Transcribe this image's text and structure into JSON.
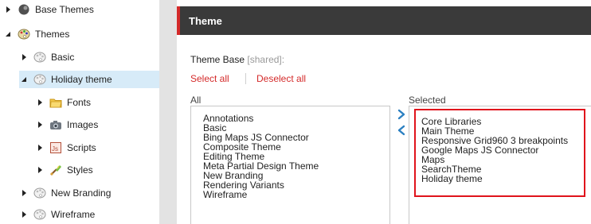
{
  "tree": {
    "items": [
      {
        "label": "Base Themes",
        "icon": "base-themes-icon",
        "expanded": false,
        "selected": false
      },
      {
        "label": "Themes",
        "icon": "themes-icon",
        "expanded": true,
        "selected": false
      },
      {
        "label": "Basic",
        "icon": "theme-icon",
        "expanded": false,
        "selected": false
      },
      {
        "label": "Holiday theme",
        "icon": "theme-icon",
        "expanded": true,
        "selected": true
      },
      {
        "label": "Fonts",
        "icon": "folder-icon",
        "expanded": false,
        "selected": false
      },
      {
        "label": "Images",
        "icon": "images-icon",
        "expanded": false,
        "selected": false
      },
      {
        "label": "Scripts",
        "icon": "script-icon",
        "expanded": false,
        "selected": false
      },
      {
        "label": "Styles",
        "icon": "styles-icon",
        "expanded": false,
        "selected": false
      },
      {
        "label": "New Branding",
        "icon": "theme-icon",
        "expanded": false,
        "selected": false
      },
      {
        "label": "Wireframe",
        "icon": "theme-icon",
        "expanded": false,
        "selected": false
      }
    ]
  },
  "panel": {
    "title": "Theme",
    "field_label": "Theme Base",
    "field_shared": "[shared]:",
    "select_all": "Select all",
    "deselect_all": "Deselect all",
    "all_label": "All",
    "selected_label": "Selected",
    "all_items": [
      "Annotations",
      "Basic",
      "Bing Maps JS Connector",
      "Composite Theme",
      "Editing Theme",
      "Meta Partial Design Theme",
      "New Branding",
      "Rendering Variants",
      "Wireframe"
    ],
    "selected_items": [
      "Core Libraries",
      "Main Theme",
      "Responsive Grid960 3 breakpoints",
      "Google Maps JS Connector",
      "Maps",
      "SearchTheme",
      "Holiday theme"
    ]
  },
  "colors": {
    "accent_red": "#d42a2a",
    "header_bg": "#3a3a3a",
    "highlight_border": "#e0131c",
    "arrow_blue": "#2a7fc1",
    "tree_selected_bg": "#d7ebf8"
  }
}
